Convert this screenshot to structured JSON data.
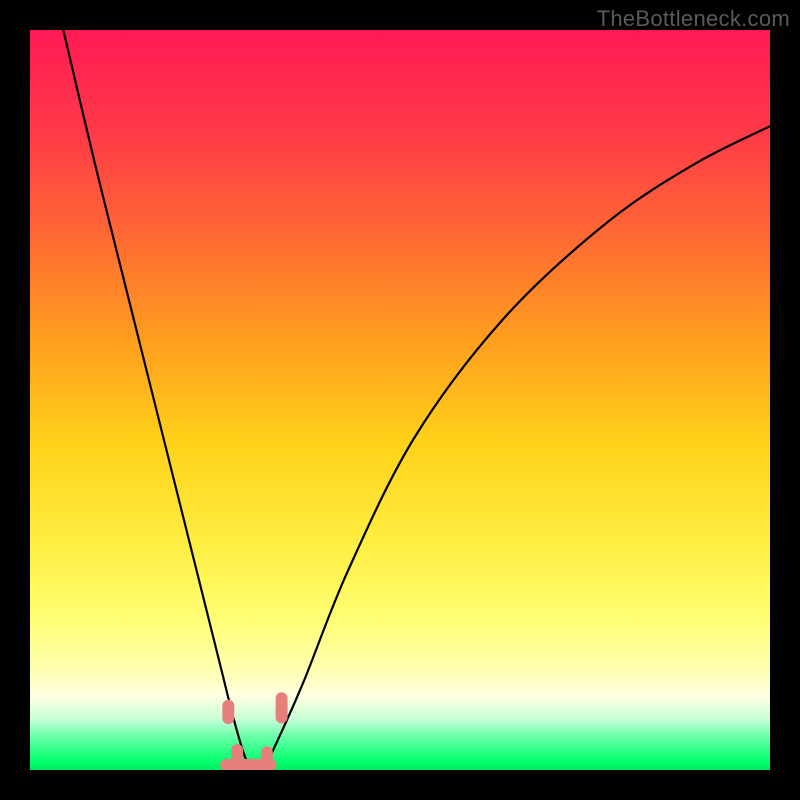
{
  "watermark": "TheBottleneck.com",
  "chart_data": {
    "type": "line",
    "title": "",
    "xlabel": "",
    "ylabel": "",
    "xlim": [
      0,
      1
    ],
    "ylim": [
      0,
      1
    ],
    "series": [
      {
        "name": "left-branch",
        "x": [
          0.045,
          0.09,
          0.135,
          0.18,
          0.22,
          0.255,
          0.275,
          0.288,
          0.296,
          0.3
        ],
        "y": [
          1.0,
          0.81,
          0.63,
          0.45,
          0.29,
          0.15,
          0.07,
          0.025,
          0.005,
          0.0
        ]
      },
      {
        "name": "right-branch",
        "x": [
          0.315,
          0.33,
          0.37,
          0.43,
          0.52,
          0.64,
          0.78,
          0.9,
          1.0
        ],
        "y": [
          0.0,
          0.03,
          0.12,
          0.27,
          0.45,
          0.61,
          0.74,
          0.82,
          0.87
        ]
      }
    ],
    "trough": {
      "left_x": 0.265,
      "right_x": 0.325,
      "bottom_y": 0.003
    },
    "markers": [
      {
        "name": "left-marker-upper",
        "x": 0.268,
        "y_top": 0.095,
        "y_bottom": 0.062
      },
      {
        "name": "left-marker-lower",
        "x": 0.28,
        "y_top": 0.035,
        "y_bottom": 0.012
      },
      {
        "name": "right-marker-upper",
        "x": 0.34,
        "y_top": 0.105,
        "y_bottom": 0.063
      },
      {
        "name": "right-marker-lower",
        "x": 0.32,
        "y_top": 0.032,
        "y_bottom": 0.007
      },
      {
        "name": "trough-bar",
        "x_left": 0.28,
        "x_right": 0.32,
        "y": 0.003
      }
    ]
  }
}
